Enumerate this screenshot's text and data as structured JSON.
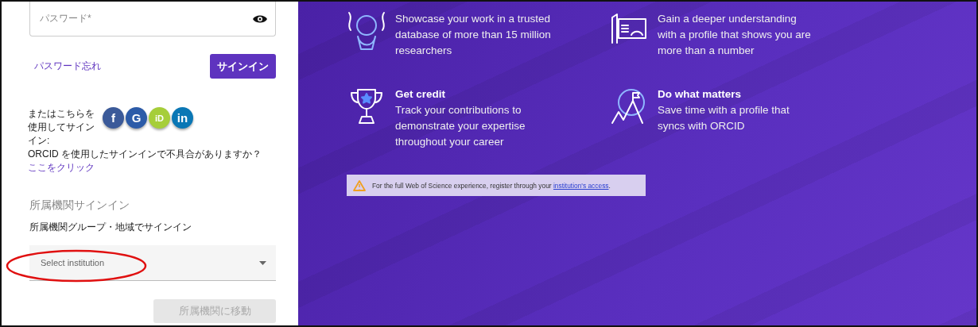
{
  "password_field": {
    "placeholder": "パスワード*"
  },
  "forgot_link": "パスワード忘れ",
  "sign_in_button": "サインイン",
  "social": {
    "label": "またはこちらを使用してサインイン:",
    "providers": [
      {
        "kind": "facebook",
        "label": "f"
      },
      {
        "kind": "google",
        "label": "G"
      },
      {
        "kind": "orcid",
        "label": "iD"
      },
      {
        "kind": "linkedin",
        "label": "in"
      }
    ]
  },
  "orcid_help": {
    "text": "ORCID を使用したサインインで不具合がありますか？ ",
    "link": "ここをクリック"
  },
  "institution": {
    "heading": "所属機関サインイン",
    "subheading": "所属機関グループ・地域でサインイン",
    "select": {
      "placeholder": "Select institution"
    },
    "button": {
      "label": "所属機関に移動",
      "disabled": true
    }
  },
  "features": [
    {
      "kind": "researchers",
      "text": "Showcase your work in a trusted database of more than 15 million researchers"
    },
    {
      "kind": "impact",
      "text": "Gain a deeper understanding with a profile that shows you are more than a number"
    },
    {
      "kind": "credit",
      "title": "Get credit",
      "text": "Track your contributions to demonstrate your expertise throughout your career"
    },
    {
      "kind": "summit",
      "title": "Do what matters",
      "text": "Save time with a profile that syncs with ORCID"
    }
  ],
  "banner": {
    "text": "For the full Web of Science experience, register through your ",
    "link": "institution's access",
    "suffix": "."
  }
}
